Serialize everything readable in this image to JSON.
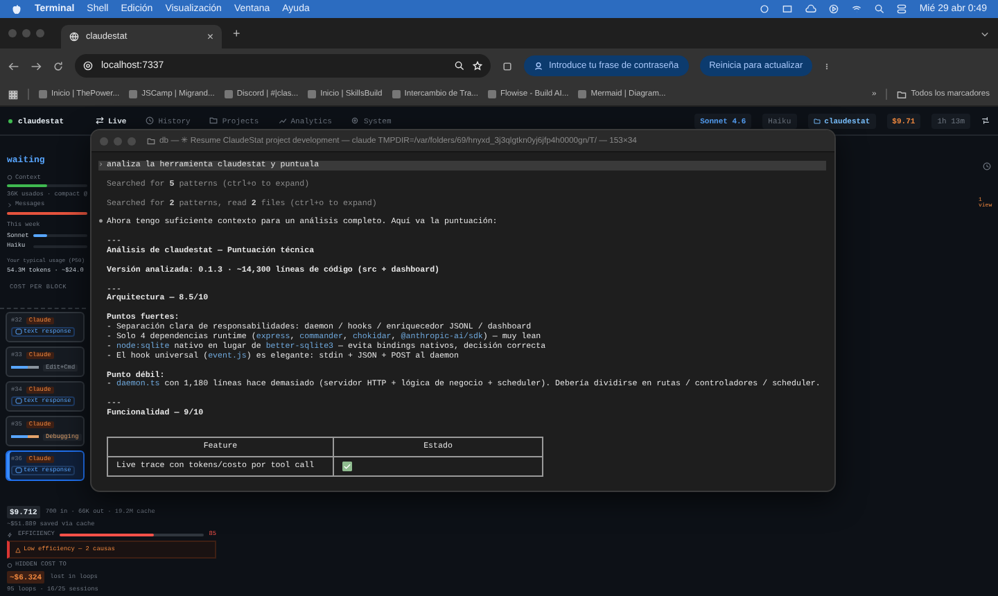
{
  "menubar": {
    "app": "Terminal",
    "menus": [
      "Shell",
      "Edición",
      "Visualización",
      "Ventana",
      "Ayuda"
    ],
    "clock": "Mié 29 abr 0:49"
  },
  "browser": {
    "tab": {
      "title": "claudestat",
      "close": "×"
    },
    "new_tab": "+",
    "url": "localhost:7337",
    "pills": [
      "Introduce tu frase de contraseña",
      "Reinicia para actualizar"
    ],
    "bookmarks": [
      "Inicio | ThePower...",
      "JSCamp | Migrand...",
      "Discord | #|clas...",
      "Inicio | SkillsBuild",
      "Intercambio de Tra...",
      "Flowise - Build AI...",
      "Mermaid | Diagram..."
    ],
    "more": "»",
    "all_bookmarks": "Todos los marcadores"
  },
  "app": {
    "brand": "claudestat",
    "nav": [
      {
        "label": "Live",
        "selected": true
      },
      {
        "label": "History",
        "selected": false
      },
      {
        "label": "Projects",
        "selected": false
      },
      {
        "label": "Analytics",
        "selected": false
      },
      {
        "label": "System",
        "selected": false
      }
    ],
    "badges": [
      {
        "text": "Sonnet 4.6",
        "kind": "model"
      },
      {
        "text": "Haiku",
        "kind": "muted"
      },
      {
        "text": "claudestat",
        "kind": "project"
      },
      {
        "text": "$9.71",
        "kind": "cost"
      },
      {
        "text": "1h 13m",
        "kind": "muted"
      }
    ],
    "sidebar": {
      "status": "waiting",
      "context": {
        "label": "Context",
        "level": 0.5,
        "note": "36K usados · compact @"
      },
      "messages": {
        "label": "Messages",
        "level": 1
      },
      "week": {
        "label": "This week",
        "models": [
          {
            "name": "Sonnet",
            "level": 0.25
          },
          {
            "name": "Haiku",
            "level": 0
          }
        ]
      },
      "typical": {
        "label": "Your typical usage (P50)",
        "value": "54.3M tokens · ~$24.0"
      },
      "cost_heading": "COST PER BLOCK",
      "blocks": [
        {
          "number": "#32",
          "agent": "Claude",
          "kind": "chip",
          "label": "text response",
          "selected": false
        },
        {
          "number": "#33",
          "agent": "Claude",
          "kind": "tag",
          "label": "Edit+Cmd",
          "color": "#8b949e",
          "selected": false
        },
        {
          "number": "#34",
          "agent": "Claude",
          "kind": "chip",
          "label": "text response",
          "selected": false
        },
        {
          "number": "#35",
          "agent": "Claude",
          "kind": "tag",
          "label": "Debugging",
          "color": "#e3a36b",
          "selected": false
        },
        {
          "number": "#36",
          "agent": "Claude",
          "kind": "chip",
          "label": "text response",
          "selected": true
        }
      ]
    },
    "summary": {
      "total": "$9.712",
      "breakdown": "700 in · 66K out · 19.2M cache",
      "saved": "~$51.889 saved via cache",
      "efficiency": {
        "label": "EFFICIENCY",
        "level": 0.65,
        "value": "85"
      },
      "alert": "Low efficiency — 2 causas",
      "hidden": {
        "label": "HIDDEN COST TO",
        "value": "~$6.324",
        "note": "lost in loops",
        "detail": "95 loops · 16/25 sessions"
      }
    },
    "side_panel": {
      "tag": "1 view"
    }
  },
  "terminal": {
    "title": "db — ✳ Resume ClaudeStat project development — claude TMPDIR=/var/folders/69/hnyxd_3j3qlgtkn0yj6jfp4h0000gn/T/ — 153×34",
    "lines": [
      {
        "kind": "prompt",
        "mark": "›",
        "text": "analiza la herramienta claudestat y puntuala"
      },
      {
        "kind": "blank"
      },
      {
        "kind": "dim",
        "parts": [
          {
            "text": "Searched for ",
            "code": false
          },
          {
            "text": "5",
            "code": true
          },
          {
            "text": " patterns (ctrl+o to expand)",
            "code": false
          }
        ]
      },
      {
        "kind": "blank"
      },
      {
        "kind": "dim",
        "parts": [
          {
            "text": "Searched for ",
            "code": false
          },
          {
            "text": "2",
            "code": true
          },
          {
            "text": " patterns, read ",
            "code": false
          },
          {
            "text": "2",
            "code": true
          },
          {
            "text": " files (ctrl+o to expand)",
            "code": false
          }
        ]
      },
      {
        "kind": "blank"
      },
      {
        "kind": "bullet",
        "mark": "●",
        "text": "Ahora tengo suficiente contexto para un análisis completo. Aquí va la puntuación:"
      },
      {
        "kind": "blank"
      },
      {
        "kind": "rule",
        "text": "---"
      },
      {
        "kind": "heading",
        "text": "Análisis de claudestat — Puntuación técnica"
      },
      {
        "kind": "blank"
      },
      {
        "kind": "heading",
        "text": "Versión analizada: 0.1.3 · ~14,300 líneas de código (src + dashboard)"
      },
      {
        "kind": "blank"
      },
      {
        "kind": "rule",
        "text": "---"
      },
      {
        "kind": "heading",
        "text": "Arquitectura — 8.5/10"
      },
      {
        "kind": "blank"
      },
      {
        "kind": "heading",
        "text": "Puntos fuertes:"
      },
      {
        "kind": "item",
        "parts": [
          {
            "text": "- Separación clara de responsabilidades: daemon / hooks / enriquecedor JSONL / dashboard",
            "code": false
          }
        ]
      },
      {
        "kind": "item",
        "parts": [
          {
            "text": "- Solo 4 dependencias runtime (",
            "code": false
          },
          {
            "text": "express",
            "code": true
          },
          {
            "text": ", ",
            "code": false
          },
          {
            "text": "commander",
            "code": true
          },
          {
            "text": ", ",
            "code": false
          },
          {
            "text": "chokidar",
            "code": true
          },
          {
            "text": ", ",
            "code": false
          },
          {
            "text": "@anthropic-ai/sdk",
            "code": true
          },
          {
            "text": ") — muy lean",
            "code": false
          }
        ]
      },
      {
        "kind": "item",
        "parts": [
          {
            "text": "- ",
            "code": false
          },
          {
            "text": "node:sqlite",
            "code": true
          },
          {
            "text": " nativo en lugar de ",
            "code": false
          },
          {
            "text": "better-sqlite3",
            "code": true
          },
          {
            "text": " — evita bindings nativos, decisión correcta",
            "code": false
          }
        ]
      },
      {
        "kind": "item",
        "parts": [
          {
            "text": "- El hook universal (",
            "code": false
          },
          {
            "text": "event.js",
            "code": true
          },
          {
            "text": ") es elegante: stdin + JSON + POST al daemon",
            "code": false
          }
        ]
      },
      {
        "kind": "blank"
      },
      {
        "kind": "heading",
        "text": "Punto débil:"
      },
      {
        "kind": "item",
        "parts": [
          {
            "text": "- ",
            "code": false
          },
          {
            "text": "daemon.ts",
            "code": true
          },
          {
            "text": " con 1,180 líneas hace demasiado (servidor HTTP + lógica de negocio + scheduler). Debería dividirse en rutas / controladores / scheduler.",
            "code": false
          }
        ]
      },
      {
        "kind": "blank"
      },
      {
        "kind": "rule",
        "text": "---"
      },
      {
        "kind": "heading",
        "text": "Funcionalidad — 9/10"
      },
      {
        "kind": "blank"
      }
    ],
    "table": {
      "columns": [
        "Feature",
        "Estado"
      ],
      "rows": [
        {
          "feature": "Live trace con tokens/costo por tool call",
          "checked": true
        }
      ]
    }
  }
}
